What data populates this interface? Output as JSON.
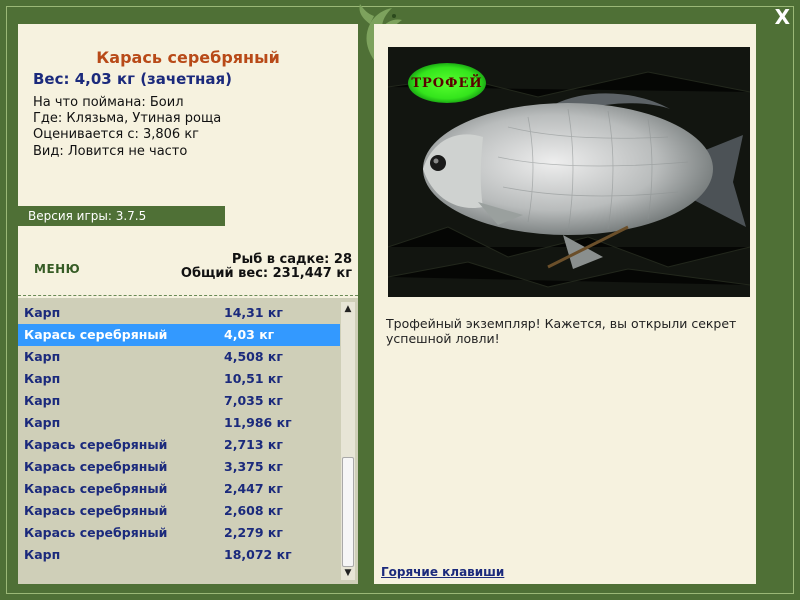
{
  "window": {
    "close_label": "X"
  },
  "fish": {
    "name": "Карась серебряный",
    "weight": "Вес: 4,03 кг (зачетная)",
    "bait": "На что поймана: Боил",
    "location": "Где: Клязьма, Утиная роща",
    "valued": "Оценивается с: 3,806 кг",
    "kind": "Вид: Ловится не часто"
  },
  "version": "Версия игры: 3.7.5",
  "menu_label": "МЕНЮ",
  "cage": {
    "count": "Рыб в садке: 28",
    "total": "Общий вес: 231,447 кг"
  },
  "catch_list": [
    {
      "name": "Карп",
      "weight": "14,31 кг"
    },
    {
      "name": "Карась серебряный",
      "weight": "4,03 кг"
    },
    {
      "name": "Карп",
      "weight": "4,508 кг"
    },
    {
      "name": "Карп",
      "weight": "10,51 кг"
    },
    {
      "name": "Карп",
      "weight": "7,035 кг"
    },
    {
      "name": "Карп",
      "weight": "11,986 кг"
    },
    {
      "name": "Карась серебряный",
      "weight": "2,713 кг"
    },
    {
      "name": "Карась серебряный",
      "weight": "3,375 кг"
    },
    {
      "name": "Карась серебряный",
      "weight": "2,447 кг"
    },
    {
      "name": "Карась серебряный",
      "weight": "2,608 кг"
    },
    {
      "name": "Карась серебряный",
      "weight": "2,279 кг"
    },
    {
      "name": "Карп",
      "weight": "18,072 кг"
    }
  ],
  "selected_index": 1,
  "photo": {
    "badge": "ТРОФЕЙ"
  },
  "description": "Трофейный экземпляр! Кажется, вы открыли секрет успешной ловли!",
  "hotkeys_label": "Горячие клавиши",
  "colors": {
    "frame": "#4f7036",
    "panel": "#f6f2df",
    "title": "#b84a18",
    "text_blue": "#1b2a7c",
    "selection": "#3399ff",
    "trophy_glow": "#34e51c"
  }
}
